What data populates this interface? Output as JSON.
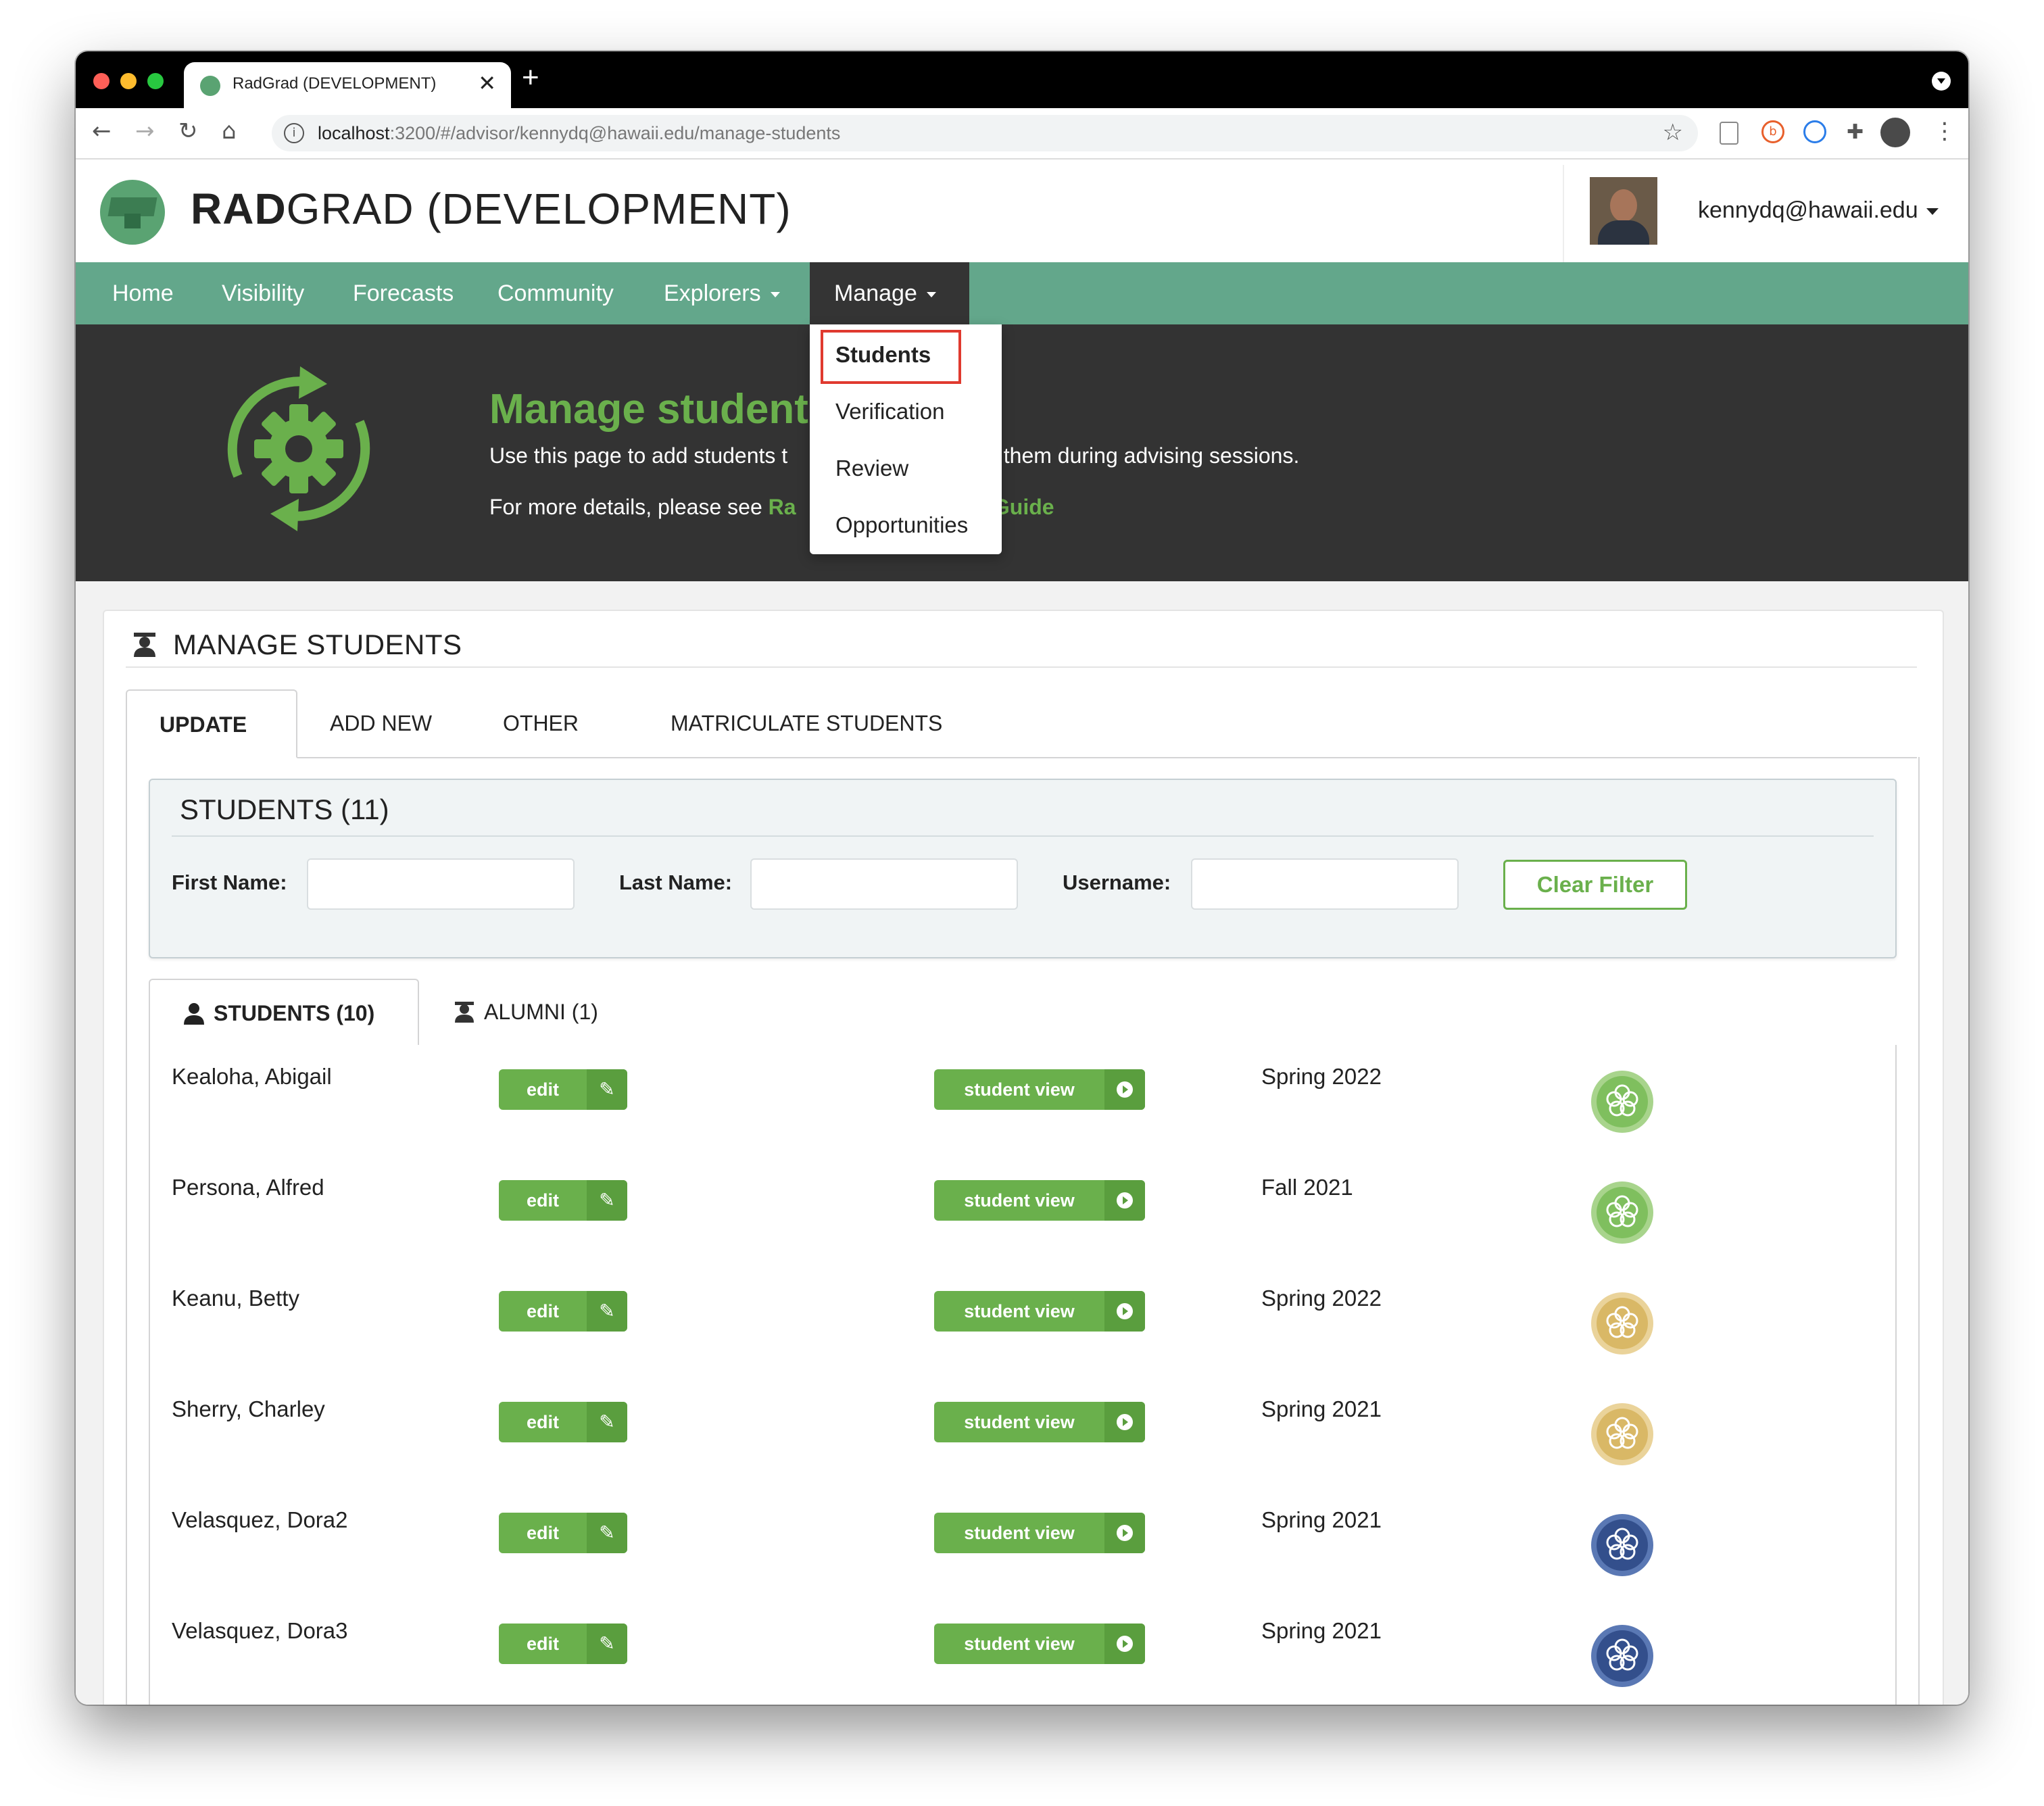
{
  "browser": {
    "tab_title": "RadGrad (DEVELOPMENT)",
    "tab_close": "✕",
    "new_tab": "+",
    "url_host": "localhost",
    "url_rest": ":3200/#/advisor/kennydq@hawaii.edu/manage-students"
  },
  "header": {
    "brand_bold": "RAD",
    "brand_rest": "GRAD (DEVELOPMENT)",
    "user": "kennydq@hawaii.edu"
  },
  "nav": {
    "items": [
      "Home",
      "Visibility",
      "Forecasts",
      "Community",
      "Explorers",
      "Manage"
    ]
  },
  "dropdown": {
    "items": [
      "Students",
      "Verification",
      "Review",
      "Opportunities"
    ],
    "highlighted": "Students"
  },
  "hero": {
    "title": "Manage student",
    "desc_a": "Use this page to add students t",
    "desc_b": "elp them during advising sessions.",
    "more_prefix": "For more details, please see ",
    "more_link_a": "Ra",
    "more_link_b": "r Guide"
  },
  "card": {
    "title": "MANAGE STUDENTS",
    "tabs": [
      "UPDATE",
      "ADD NEW",
      "OTHER",
      "MATRICULATE STUDENTS"
    ]
  },
  "filter": {
    "title": "STUDENTS (11)",
    "first_name_label": "First Name:",
    "last_name_label": "Last Name:",
    "username_label": "Username:",
    "first_name_value": "",
    "last_name_value": "",
    "username_value": "",
    "clear_label": "Clear Filter"
  },
  "subtabs": {
    "students": "STUDENTS (10)",
    "alumni": "ALUMNI (1)"
  },
  "row_buttons": {
    "edit": "edit",
    "view": "student view"
  },
  "students": [
    {
      "name": "Kealoha, Abigail",
      "term": "Spring 2022",
      "level": "green"
    },
    {
      "name": "Persona, Alfred",
      "term": "Fall 2021",
      "level": "green"
    },
    {
      "name": "Keanu, Betty",
      "term": "Spring 2022",
      "level": "gold"
    },
    {
      "name": "Sherry, Charley",
      "term": "Spring 2021",
      "level": "gold"
    },
    {
      "name": "Velasquez, Dora2",
      "term": "Spring 2021",
      "level": "blue"
    },
    {
      "name": "Velasquez, Dora3",
      "term": "Spring 2021",
      "level": "blue"
    }
  ],
  "colors": {
    "nav": "#63a78b",
    "accent_green": "#6ab04c",
    "hero_bg": "#333333",
    "highlight_red": "#e03a2f",
    "level_green": "#7fbf5e",
    "level_gold": "#d9b866",
    "level_blue": "#334f8c"
  },
  "icons": [
    "back-icon",
    "forward-icon",
    "reload-icon",
    "home-icon",
    "info-icon",
    "star-icon",
    "extensions-icon",
    "menu-icon",
    "gear-sync-icon",
    "graduate-icon",
    "user-icon",
    "edit-icon",
    "arrow-circle-icon",
    "level-badge-icon"
  ]
}
